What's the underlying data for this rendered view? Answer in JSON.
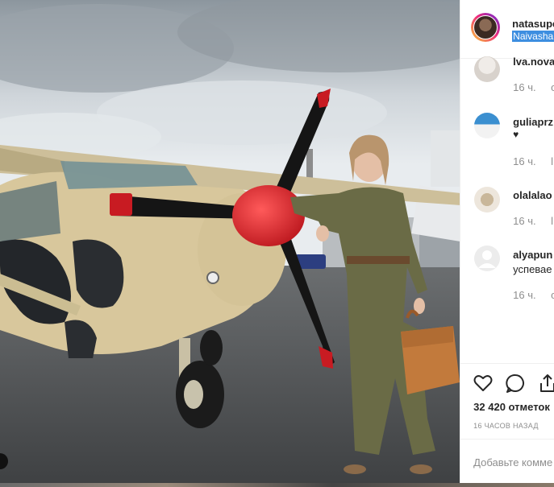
{
  "post": {
    "username": "natasupe",
    "location": "Naivasha",
    "likes": "32 420 отметок",
    "time": "16 ЧАСОВ НАЗАД",
    "add_comment_placeholder": "Добавьте комме"
  },
  "comments": [
    {
      "user": "lva.nova",
      "text": "",
      "time": "16 ч.",
      "reply": "o"
    },
    {
      "user": "guliaprz",
      "text": "♥",
      "time": "16 ч.",
      "reply": "l"
    },
    {
      "user": "olalalao",
      "text": "",
      "time": "16 ч.",
      "reply": "l"
    },
    {
      "user": "alyapun",
      "text": "успевае",
      "time": "16 ч.",
      "reply": "o"
    }
  ],
  "icons": [
    "heart-icon",
    "comment-icon",
    "share-icon"
  ],
  "colors": {
    "location_highlight": "#3d8ee0",
    "propeller_spinner": "#e0222a"
  }
}
